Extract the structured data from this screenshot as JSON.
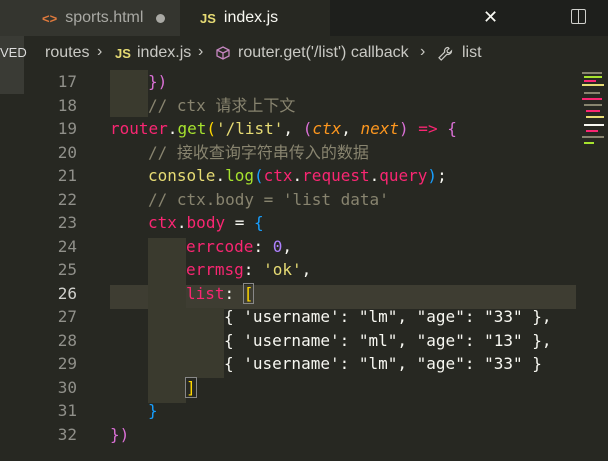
{
  "tabs": [
    {
      "icon": "<>",
      "label": "sports.html",
      "modified": true,
      "active": false
    },
    {
      "icon": "JS",
      "label": "index.js",
      "active": true
    }
  ],
  "tab_close": "✕",
  "breadcrumb": {
    "left_stub": "VED",
    "items": [
      "routes",
      "index.js",
      "router.get('/list') callback",
      "list"
    ],
    "js_icon": "JS"
  },
  "line_numbers": [
    "17",
    "18",
    "19",
    "20",
    "21",
    "22",
    "23",
    "24",
    "25",
    "26",
    "27",
    "28",
    "29",
    "30",
    "31",
    "32"
  ],
  "code": {
    "l17": "})",
    "l18": "// ctx 请求上下文",
    "l19_a": "router",
    "l19_b": ".",
    "l19_c": "get",
    "l19_d": "(",
    "l19_e": "'/list'",
    "l19_f": ", ",
    "l19_g": "(",
    "l19_h": "ctx",
    "l19_i": ", ",
    "l19_j": "next",
    "l19_k": ")",
    "l19_l": " => ",
    "l19_m": "{",
    "l20": "// 接收查询字符串传入的数据",
    "l21_a": "console",
    "l21_b": ".",
    "l21_c": "log",
    "l21_d": "(",
    "l21_e": "ctx",
    "l21_f": ".",
    "l21_g": "request",
    "l21_h": ".",
    "l21_i": "query",
    "l21_j": ")",
    "l21_k": ";",
    "l22": "// ctx.body = 'list data'",
    "l23_a": "ctx",
    "l23_b": ".",
    "l23_c": "body",
    "l23_d": " = ",
    "l23_e": "{",
    "l24_a": "errcode",
    "l24_b": ": ",
    "l24_c": "0",
    "l24_d": ",",
    "l25_a": "errmsg",
    "l25_b": ": ",
    "l25_c": "'ok'",
    "l25_d": ",",
    "l26_a": "list",
    "l26_b": ": ",
    "l26_c": "[",
    "l27": "{ 'username': \"lm\", \"age\": \"33\" },",
    "l28": "{ 'username': \"ml\", \"age\": \"13\" },",
    "l29": "{ 'username': \"lm\", \"age\": \"33\" }",
    "l30": "]",
    "l31": "}",
    "l32": "})"
  }
}
